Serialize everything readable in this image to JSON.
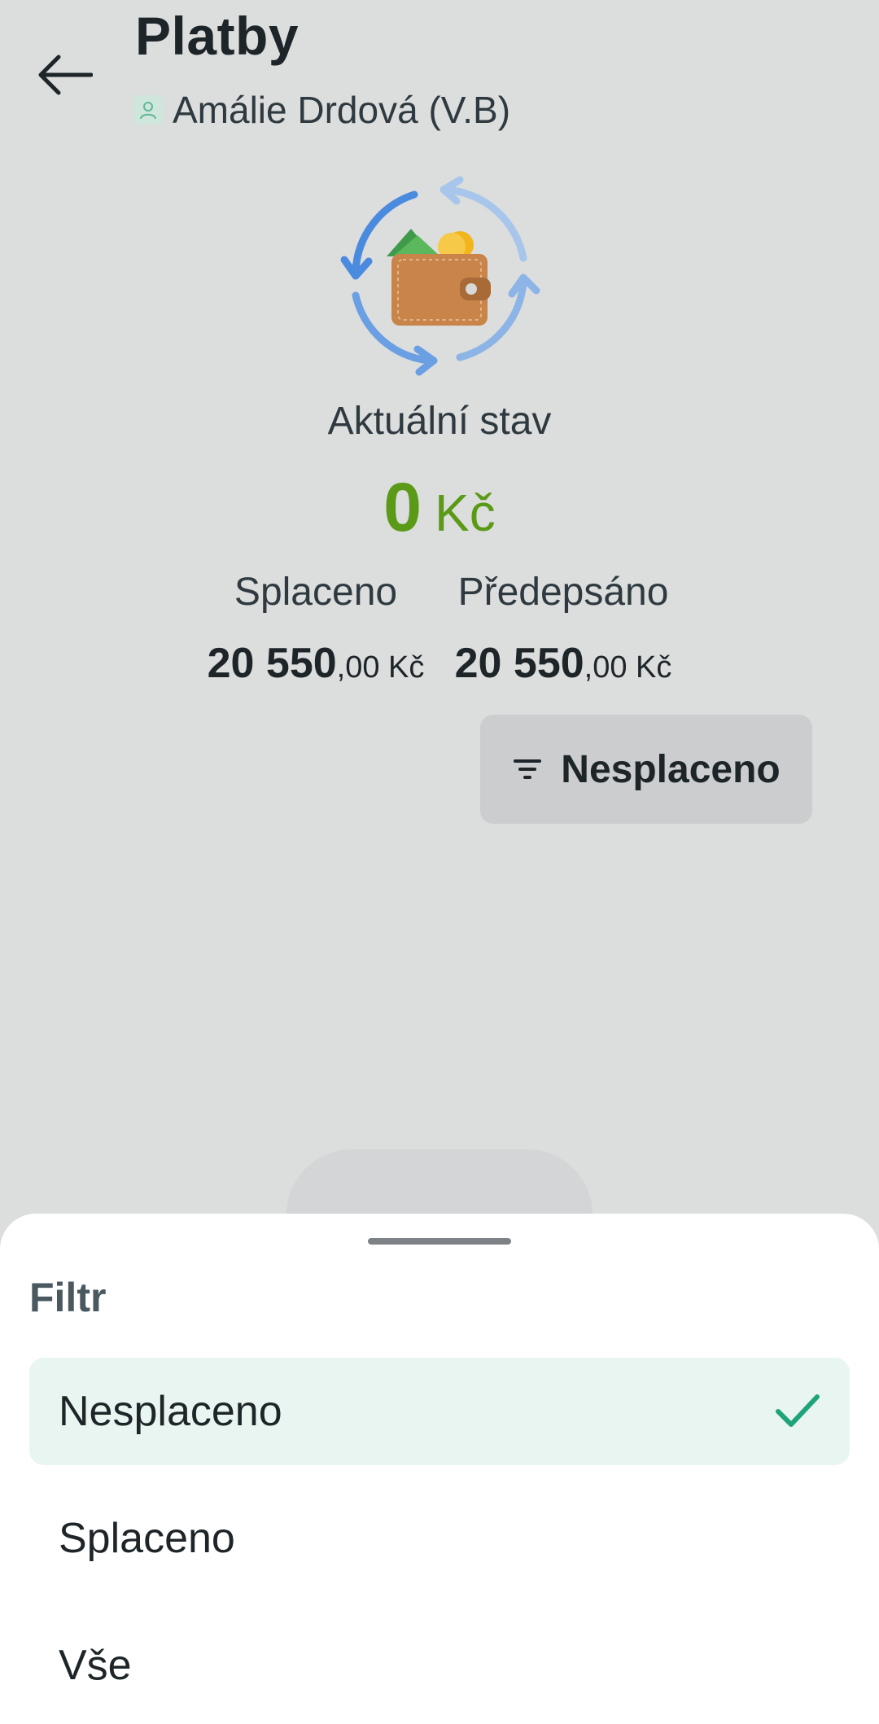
{
  "header": {
    "title": "Platby",
    "subtitle": "Amálie Drdová (V.B)"
  },
  "summary": {
    "status_label": "Aktuální stav",
    "balance_amount": "0",
    "balance_currency": "Kč",
    "paid": {
      "label": "Splaceno",
      "whole": "20 550",
      "decimal": ",00",
      "currency": " Kč"
    },
    "prescribed": {
      "label": "Předepsáno",
      "whole": "20 550",
      "decimal": ",00",
      "currency": " Kč"
    }
  },
  "filter_button": {
    "label": "Nesplaceno"
  },
  "sheet": {
    "title": "Filtr",
    "options": [
      {
        "label": "Nesplaceno",
        "selected": true
      },
      {
        "label": "Splaceno",
        "selected": false
      },
      {
        "label": "Vše",
        "selected": false
      }
    ]
  },
  "colors": {
    "background": "#dcdddd",
    "balance_green": "#5a9a16",
    "selected_bg": "#e9f5f0",
    "check_green": "#1fa37a"
  }
}
